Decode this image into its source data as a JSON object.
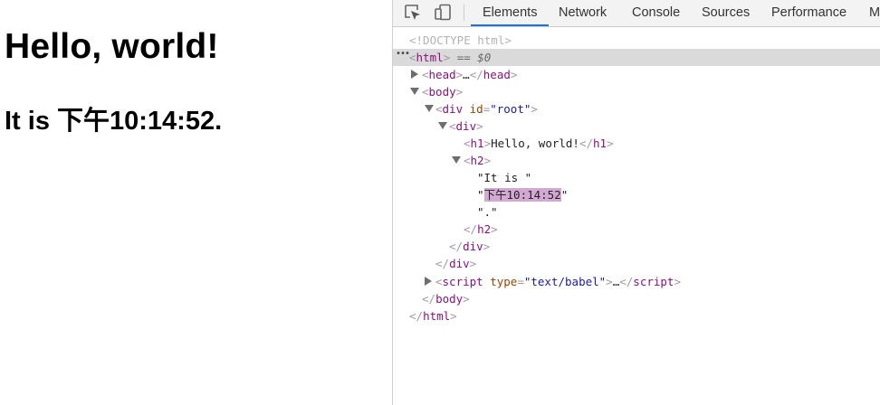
{
  "page": {
    "heading": "Hello, world!",
    "subheading": "It is 下午10:14:52."
  },
  "devtools": {
    "tabs": [
      "Elements",
      "Network",
      "Console",
      "Sources",
      "Performance",
      "M"
    ],
    "active_tab": "Elements",
    "tree": {
      "doctype": "<!DOCTYPE html>",
      "html_open": "html",
      "dollar_zero": "== $0",
      "head": "head",
      "head_ellipsis": "…",
      "body": "body",
      "div_root_tag": "div",
      "div_root_attr": "id",
      "div_root_val": "\"root\"",
      "div_inner": "div",
      "h1": "h1",
      "h1_text": "Hello, world!",
      "h2": "h2",
      "text1": "\"It is \"",
      "text2_quote_open": "\"",
      "text2_value": "下午10:14:52",
      "text2_quote_close": "\"",
      "text3": "\".\"",
      "script_tag": "script",
      "script_attr": "type",
      "script_val": "\"text/babel\"",
      "script_ellipsis": "…"
    }
  }
}
